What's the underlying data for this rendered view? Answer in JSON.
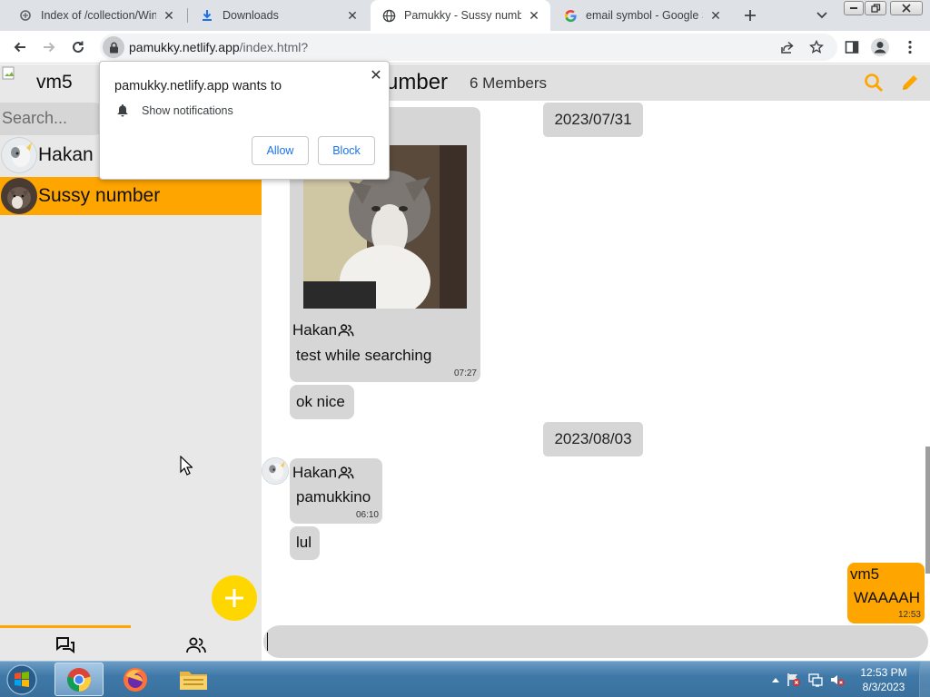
{
  "browser": {
    "tabs": [
      {
        "title": "Index of /collection/Wind",
        "icon": "index-page-icon"
      },
      {
        "title": "Downloads",
        "icon": "download-icon"
      },
      {
        "title": "Pamukky - Sussy number",
        "icon": "globe-icon"
      },
      {
        "title": "email symbol - Google Se",
        "icon": "google-icon"
      }
    ],
    "active_tab": 2,
    "url_host": "pamukky.netlify.app",
    "url_rest": "/index.html?"
  },
  "permission_popup": {
    "title": "pamukky.netlify.app wants to",
    "permission": "Show notifications",
    "allow_label": "Allow",
    "block_label": "Block"
  },
  "sidebar": {
    "username": "vm5",
    "search_placeholder": "Search...",
    "contacts": [
      {
        "name": "Hakan",
        "selected": false
      },
      {
        "name": "Sussy number",
        "selected": true
      }
    ]
  },
  "chat": {
    "title": "Sussy number",
    "title_visible": "umber",
    "members": "6 Members",
    "messages": [
      {
        "type": "date",
        "text": "2023/07/31"
      },
      {
        "type": "image",
        "sender": "Hakan",
        "text": "test while searching",
        "time": "07:27"
      },
      {
        "type": "text",
        "text": "ok nice"
      },
      {
        "type": "date",
        "text": "2023/08/03"
      },
      {
        "type": "text",
        "sender": "Hakan",
        "text": "pamukkino",
        "time": "06:10"
      },
      {
        "type": "text",
        "text": "lul"
      },
      {
        "type": "mine",
        "sender": "vm5",
        "text": "WAAAAH",
        "time": "12:53"
      }
    ]
  },
  "taskbar": {
    "time": "12:53 PM",
    "date": "8/3/2023"
  },
  "colors": {
    "accent": "#ffa500",
    "fab": "#ffd700",
    "bubble": "#d6d6d6"
  }
}
